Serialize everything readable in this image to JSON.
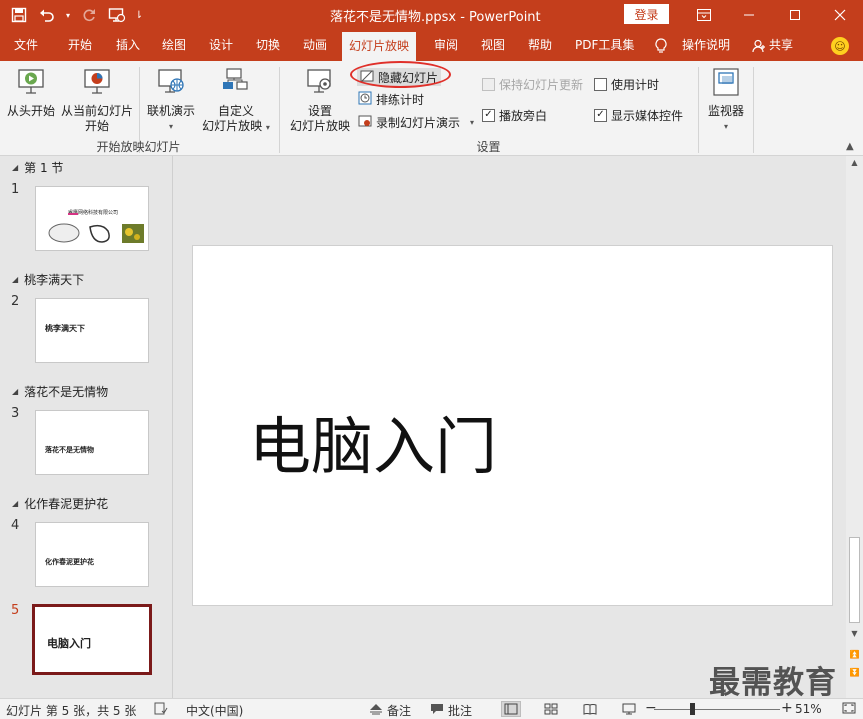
{
  "titlebar": {
    "doc_title": "落花不是无情物.ppsx  -  PowerPoint",
    "login_label": "登录"
  },
  "tabs": [
    {
      "label": "文件"
    },
    {
      "label": "开始"
    },
    {
      "label": "插入"
    },
    {
      "label": "绘图"
    },
    {
      "label": "设计"
    },
    {
      "label": "切换"
    },
    {
      "label": "动画"
    },
    {
      "label": "幻灯片放映",
      "active": true
    },
    {
      "label": "审阅"
    },
    {
      "label": "视图"
    },
    {
      "label": "帮助"
    },
    {
      "label": "PDF工具集"
    },
    {
      "label": "操作说明"
    },
    {
      "label": "共享"
    }
  ],
  "ribbon": {
    "start_group": {
      "label": "开始放映幻灯片",
      "from_beginning": "从头开始",
      "from_current_1": "从当前幻灯片",
      "from_current_2": "开始",
      "online": "联机演示",
      "custom_1": "自定义",
      "custom_2": "幻灯片放映"
    },
    "setup_group": {
      "label": "设置",
      "setup_1": "设置",
      "setup_2": "幻灯片放映",
      "hide_slide": "隐藏幻灯片",
      "rehearse": "排练计时",
      "record": "录制幻灯片演示",
      "keep_updated": "保持幻灯片更新",
      "use_timings": "使用计时",
      "play_narrations": "播放旁白",
      "show_media_controls": "显示媒体控件"
    },
    "monitor_group": {
      "monitor": "监视器"
    }
  },
  "slides": [
    {
      "section": "第 1 节",
      "num": "1",
      "text": "睿鹰网络科技有限公司"
    },
    {
      "section": "桃李满天下",
      "num": "2",
      "text": "桃李满天下"
    },
    {
      "section": "落花不是无情物",
      "num": "3",
      "text": "落花不是无情物"
    },
    {
      "section": "化作春泥更护花",
      "num": "4",
      "text": "化作春泥更护花"
    },
    {
      "section": "",
      "num": "5",
      "text": "电脑入门"
    }
  ],
  "main_slide": {
    "title": "电脑入门"
  },
  "statusbar": {
    "slide_info": "幻灯片 第 5 张，共 5 张",
    "language": "中文(中国)",
    "notes": "备注",
    "comments": "批注",
    "zoom": "51%"
  },
  "watermark": "最需教育",
  "colors": {
    "accent": "#c43e1c",
    "highlight_ellipse": "#e0302a",
    "active_thumb_border": "#7b1a1a"
  }
}
